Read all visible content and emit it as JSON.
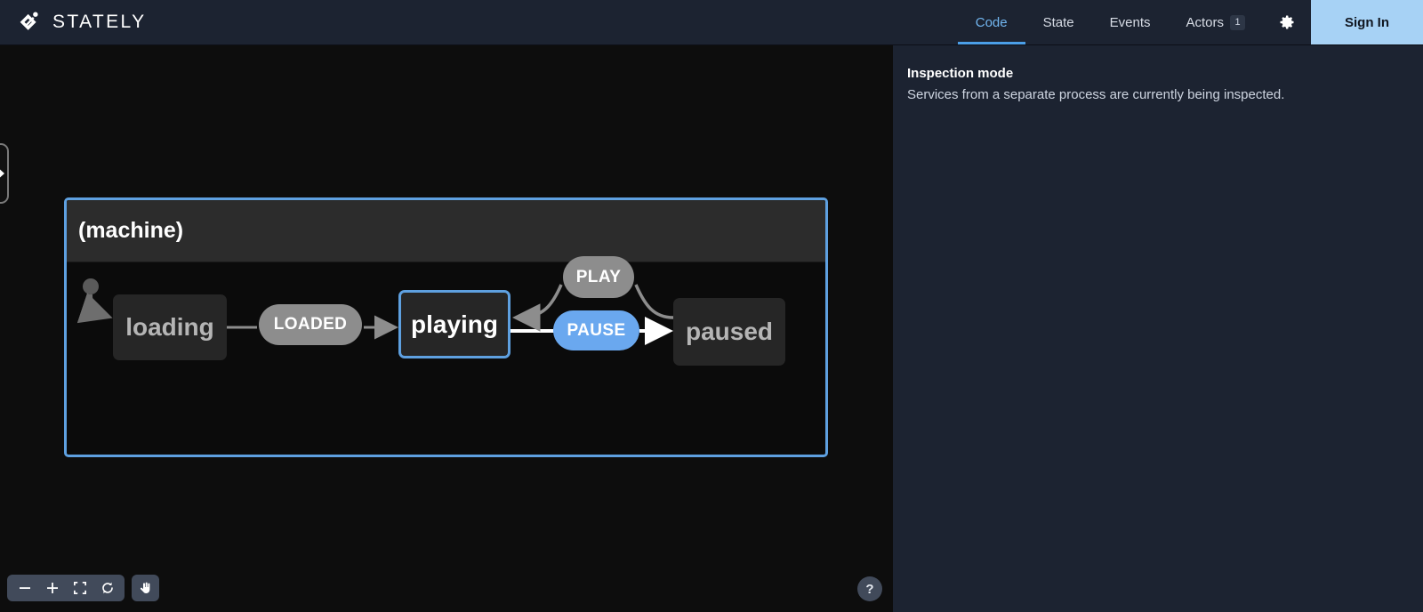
{
  "brand": {
    "name": "STATELY",
    "logo_icon": "stately-diamond-logo"
  },
  "topnav": {
    "tabs": [
      {
        "label": "Code",
        "active": true,
        "badge": ""
      },
      {
        "label": "State",
        "active": false,
        "badge": ""
      },
      {
        "label": "Events",
        "active": false,
        "badge": ""
      },
      {
        "label": "Actors",
        "active": false,
        "badge": "1"
      }
    ],
    "settings_icon": "gear-icon",
    "signin_label": "Sign In",
    "accent_color": "#4b9fe8",
    "signin_bg": "#a7d2f5"
  },
  "panel": {
    "title": "Inspection mode",
    "description": "Services from a separate process are currently being inspected."
  },
  "canvas": {
    "drawer_toggle_icon": "chevron-right-icon",
    "help_label": "?",
    "zoom_tools": [
      {
        "name": "zoom-out-button",
        "icon": "minus-icon"
      },
      {
        "name": "zoom-in-button",
        "icon": "plus-icon"
      },
      {
        "name": "fit-to-view-button",
        "icon": "fit-screen-icon"
      },
      {
        "name": "reset-button",
        "icon": "reset-circle-icon"
      }
    ],
    "pan_tool": {
      "name": "pan-hand-button",
      "icon": "hand-icon"
    }
  },
  "statechart": {
    "machine_label": "(machine)",
    "machine_border_color": "#5ea0e0",
    "active_state": "playing",
    "states": [
      {
        "id": "loading",
        "label": "loading",
        "active": false,
        "initial": true
      },
      {
        "id": "playing",
        "label": "playing",
        "active": true,
        "initial": false
      },
      {
        "id": "paused",
        "label": "paused",
        "active": false,
        "initial": false
      }
    ],
    "transitions": [
      {
        "event": "LOADED",
        "from": "loading",
        "to": "playing",
        "highlighted": false,
        "color": "#8d8d8d"
      },
      {
        "event": "PAUSE",
        "from": "playing",
        "to": "paused",
        "highlighted": true,
        "color": "#6aa8ef"
      },
      {
        "event": "PLAY",
        "from": "paused",
        "to": "playing",
        "highlighted": false,
        "color": "#8d8d8d"
      }
    ]
  }
}
